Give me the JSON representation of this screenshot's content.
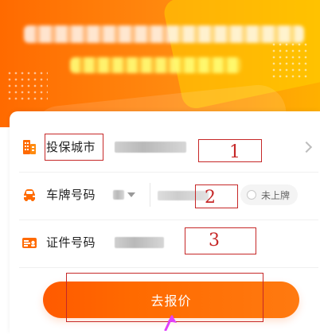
{
  "form": {
    "fields": [
      {
        "label": "投保城市",
        "icon": "building-icon"
      },
      {
        "label": "车牌号码",
        "icon": "car-icon",
        "toggle_label": "未上牌"
      },
      {
        "label": "证件号码",
        "icon": "id-card-icon"
      }
    ],
    "submit_label": "去报价"
  },
  "annotations": {
    "labels": [
      "1",
      "2",
      "3"
    ]
  },
  "colors": {
    "brand_orange": "#ff6a00",
    "brand_orange_light": "#ffb000",
    "annotation_red": "#c62828"
  }
}
